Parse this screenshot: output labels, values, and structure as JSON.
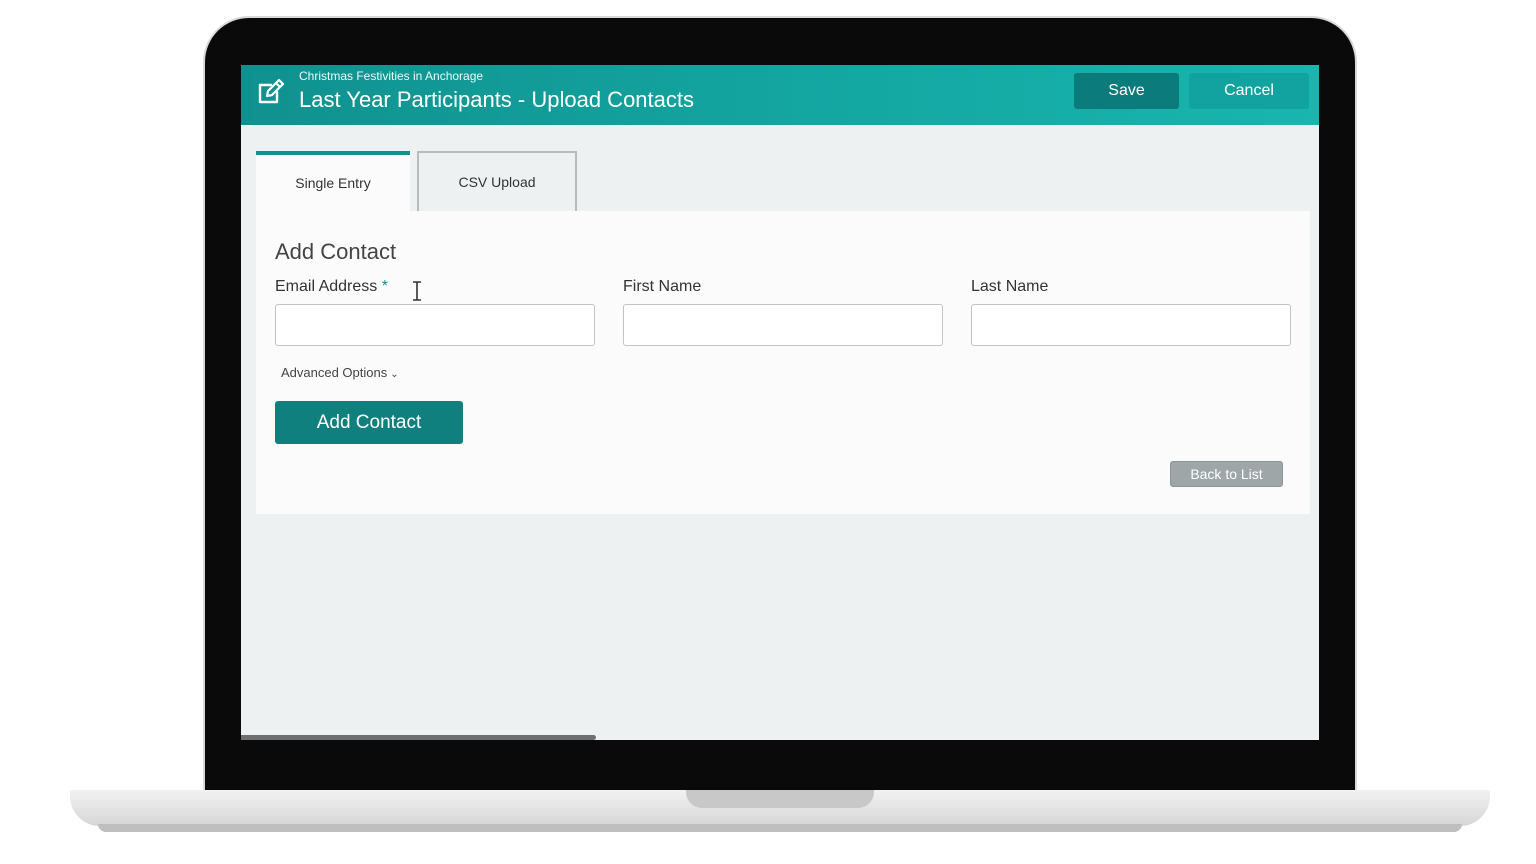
{
  "header": {
    "subtitle": "Christmas Festivities in Anchorage",
    "title": "Last Year Participants - Upload Contacts",
    "save_label": "Save",
    "cancel_label": "Cancel",
    "icon": "edit-icon"
  },
  "tabs": [
    {
      "label": "Single Entry",
      "active": true
    },
    {
      "label": "CSV Upload",
      "active": false
    }
  ],
  "form": {
    "title": "Add Contact",
    "fields": [
      {
        "label": "Email Address",
        "required_marker": "*",
        "value": "",
        "placeholder": ""
      },
      {
        "label": "First Name",
        "value": "",
        "placeholder": ""
      },
      {
        "label": "Last Name",
        "value": "",
        "placeholder": ""
      }
    ],
    "advanced_options": "Advanced Options",
    "add_button": "Add Contact",
    "back_button": "Back to List"
  },
  "colors": {
    "brand_teal": "#12918f",
    "button_dark_teal": "#10807f",
    "back_button_gray": "#9ea6a8"
  }
}
